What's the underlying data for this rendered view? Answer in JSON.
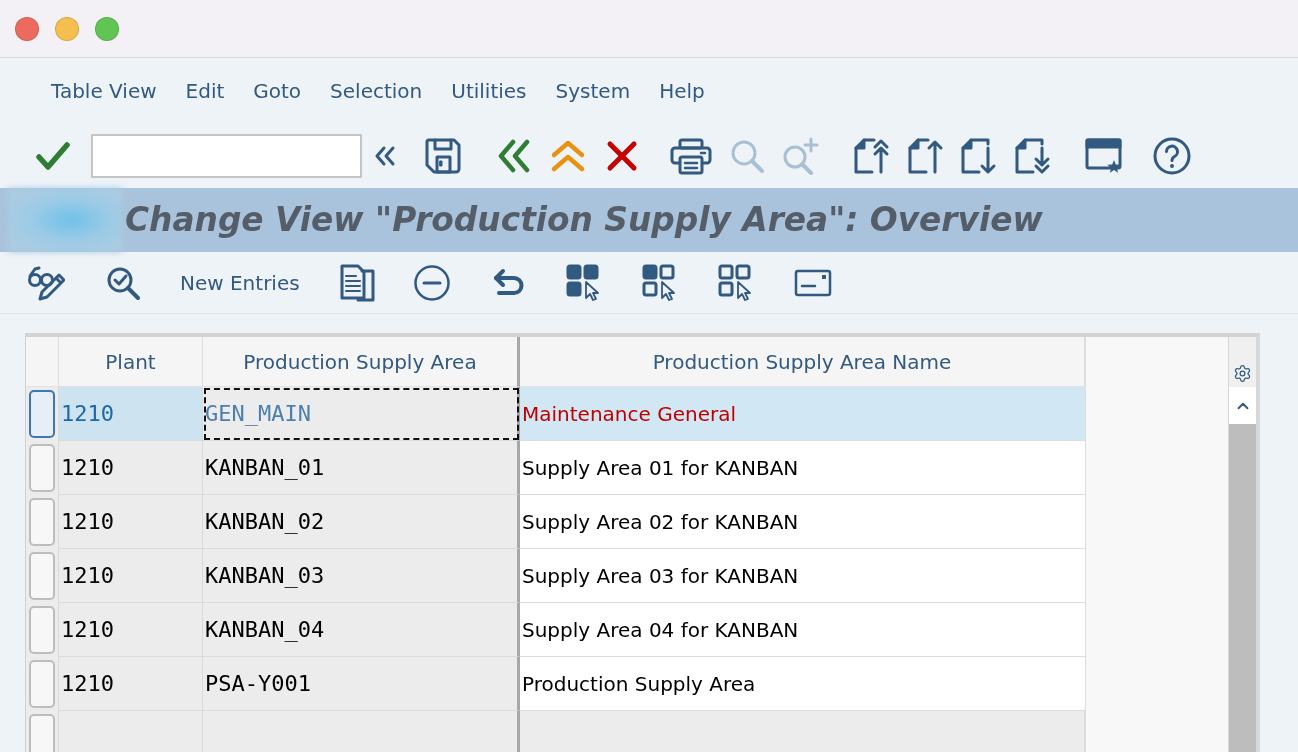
{
  "menu_bar": [
    "Table View",
    "Edit",
    "Goto",
    "Selection",
    "Utilities",
    "System",
    "Help"
  ],
  "toolbar": {
    "items": [
      {
        "kind": "enter",
        "disabled": false
      },
      {
        "kind": "command_field",
        "disabled": false
      },
      {
        "kind": "collapse",
        "disabled": false
      },
      {
        "kind": "save",
        "disabled": false
      },
      {
        "kind": "back",
        "disabled": false
      },
      {
        "kind": "exit",
        "disabled": false
      },
      {
        "kind": "cancel",
        "disabled": false
      },
      {
        "kind": "print",
        "disabled": false
      },
      {
        "kind": "find",
        "disabled": true
      },
      {
        "kind": "find_next",
        "disabled": true
      },
      {
        "kind": "first_page",
        "disabled": false
      },
      {
        "kind": "previous_page",
        "disabled": false
      },
      {
        "kind": "next_page",
        "disabled": false
      },
      {
        "kind": "last_page",
        "disabled": false
      },
      {
        "kind": "new_session",
        "disabled": false
      },
      {
        "kind": "help",
        "disabled": false
      }
    ]
  },
  "title": "Change View \"Production Supply Area\": Overview",
  "app_toolbar": {
    "items": [
      {
        "kind": "display_change"
      },
      {
        "kind": "check"
      },
      {
        "kind": "text",
        "label": "New Entries"
      },
      {
        "kind": "copy"
      },
      {
        "kind": "delete"
      },
      {
        "kind": "undo"
      },
      {
        "kind": "select_all"
      },
      {
        "kind": "select_block"
      },
      {
        "kind": "deselect_all"
      },
      {
        "kind": "details"
      }
    ]
  },
  "table": {
    "columns": [
      "Plant",
      "Production Supply Area",
      "Production Supply Area Name"
    ],
    "rows": [
      {
        "plant": "1210",
        "supply_area": "GEN_MAIN",
        "name": "Maintenance General",
        "selected": true,
        "focused": true
      },
      {
        "plant": "1210",
        "supply_area": "KANBAN_01",
        "name": "Supply Area 01 for KANBAN",
        "selected": false,
        "focused": false
      },
      {
        "plant": "1210",
        "supply_area": "KANBAN_02",
        "name": "Supply Area 02 for KANBAN",
        "selected": false,
        "focused": false
      },
      {
        "plant": "1210",
        "supply_area": "KANBAN_03",
        "name": "Supply Area 03 for KANBAN",
        "selected": false,
        "focused": false
      },
      {
        "plant": "1210",
        "supply_area": "KANBAN_04",
        "name": "Supply Area 04 for KANBAN",
        "selected": false,
        "focused": false
      },
      {
        "plant": "1210",
        "supply_area": "PSA-Y001",
        "name": "Production Supply Area",
        "selected": false,
        "focused": false
      }
    ]
  }
}
